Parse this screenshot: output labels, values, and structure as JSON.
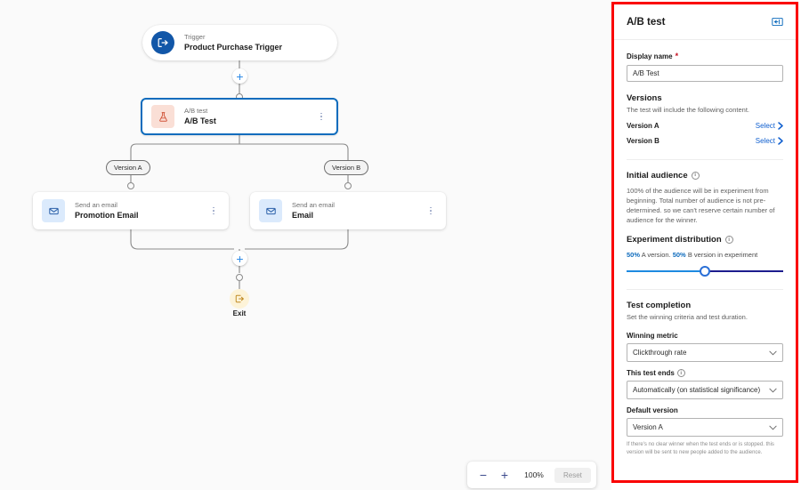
{
  "canvas": {
    "nodes": [
      {
        "id": "trigger",
        "sub": "Trigger",
        "title": "Product Purchase Trigger",
        "icon": "trigger-arrow-icon"
      },
      {
        "id": "abtest",
        "sub": "A/B test",
        "title": "A/B Test",
        "icon": "flask-icon"
      },
      {
        "id": "email-a",
        "sub": "Send an email",
        "title": "Promotion Email",
        "icon": "envelope-icon"
      },
      {
        "id": "email-b",
        "sub": "Send an email",
        "title": "Email",
        "icon": "envelope-icon"
      }
    ],
    "branches": [
      {
        "label": "Version A"
      },
      {
        "label": "Version B"
      }
    ],
    "exit": {
      "label": "Exit",
      "icon": "exit-arrow-icon"
    },
    "add_step_tooltip": "+"
  },
  "zoombar": {
    "zoom_out_label": "−",
    "zoom_in_label": "+",
    "level": "100%",
    "reset_label": "Reset"
  },
  "panel": {
    "title": "A/B test",
    "collapse_icon": "collapse-panel-icon",
    "display_name": {
      "label": "Display name",
      "required_mark": "*",
      "value": "A/B Test"
    },
    "versions": {
      "heading": "Versions",
      "description": "The test will include the following content.",
      "rows": [
        {
          "name": "Version A",
          "action": "Select"
        },
        {
          "name": "Version B",
          "action": "Select"
        }
      ]
    },
    "initial_audience": {
      "heading": "Initial audience",
      "description": "100% of the audience will be in experiment from beginning. Total number of audience is not pre-determined. so we can't reserve certain number of audience for the winner."
    },
    "experiment_distribution": {
      "heading": "Experiment distribution",
      "a_percent": "50%",
      "a_text": "A version.",
      "b_percent": "50%",
      "b_text": "B version in experiment",
      "slider_value": 50
    },
    "test_completion": {
      "heading": "Test completion",
      "description": "Set the winning criteria and test duration.",
      "winning_metric": {
        "label": "Winning metric",
        "value": "Clickthrough rate"
      },
      "test_ends": {
        "label": "This test ends",
        "value": "Automatically (on statistical significance)"
      },
      "default_version": {
        "label": "Default version",
        "value": "Version A",
        "hint": "If there's no clear winner when the test ends or is stopped. this version will be sent to new people added to the audience."
      }
    }
  },
  "colors": {
    "accent": "#0f6cbd",
    "link": "#0f5fcf",
    "required": "#c50f1f",
    "annotation": "#fa0000",
    "slider_left": "#1e8ae0",
    "slider_right": "#1d1d8e"
  }
}
